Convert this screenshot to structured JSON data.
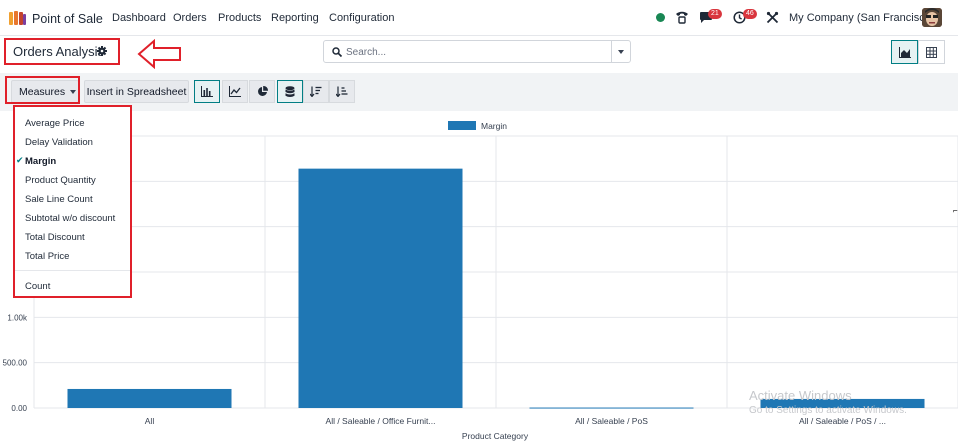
{
  "navbar": {
    "app_name": "Point of Sale",
    "menu": [
      "Dashboard",
      "Orders",
      "Products",
      "Reporting",
      "Configuration"
    ],
    "chat_badge": "21",
    "activity_badge": "46",
    "company": "My Company (San Francisco)",
    "status_color": "#198754"
  },
  "control_panel": {
    "title": "Orders Analysis",
    "search_placeholder": "Search...",
    "measures_label": "Measures",
    "spreadsheet_label": "Insert in Spreadsheet"
  },
  "measures_menu": {
    "items": [
      {
        "label": "Average Price",
        "checked": false
      },
      {
        "label": "Delay Validation",
        "checked": false
      },
      {
        "label": "Margin",
        "checked": true
      },
      {
        "label": "Product Quantity",
        "checked": false
      },
      {
        "label": "Sale Line Count",
        "checked": false
      },
      {
        "label": "Subtotal w/o discount",
        "checked": false
      },
      {
        "label": "Total Discount",
        "checked": false
      },
      {
        "label": "Total Price",
        "checked": false
      }
    ],
    "count_label": "Count"
  },
  "chart_data": {
    "type": "bar",
    "categories": [
      "All",
      "All / Saleable / Office Furnit...",
      "All / Saleable / PoS",
      "All / Saleable / PoS / ..."
    ],
    "series": [
      {
        "name": "Margin",
        "values": [
          210,
          2640,
          5,
          100
        ],
        "color": "#1f77b4"
      }
    ],
    "xlabel": "Product Category",
    "ylabel": "",
    "y_ticks": [
      "0.00",
      "500.00",
      "1.00k"
    ],
    "ylim": [
      0,
      3000
    ],
    "grid": true,
    "legend": "top-center"
  },
  "watermark": {
    "line1": "Activate Windows",
    "line2": "Go to Settings to activate Windows."
  },
  "colors": {
    "accent": "#017e84",
    "bar": "#1f77b4",
    "highlight": "#e0202a"
  }
}
